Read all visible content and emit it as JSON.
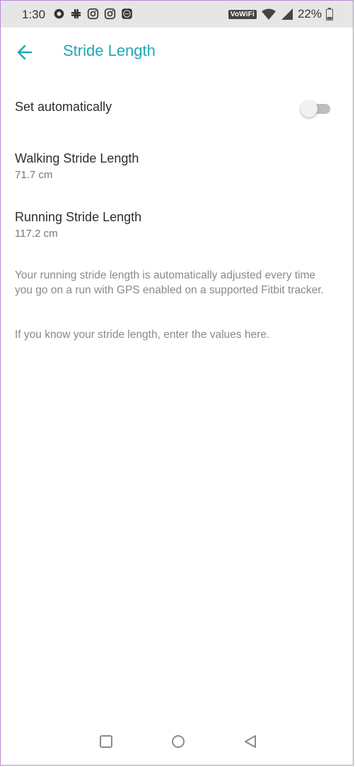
{
  "status_bar": {
    "time": "1:30",
    "left_icons": [
      "o-circle-icon",
      "slack-icon",
      "instagram-icon",
      "instagram-icon",
      "fitbit-icon"
    ],
    "vowifi": "VoWiFi",
    "battery": "22%"
  },
  "app_bar": {
    "title": "Stride Length",
    "back_icon": "arrow-left-icon"
  },
  "settings": {
    "auto": {
      "label": "Set automatically",
      "enabled": false
    },
    "walking": {
      "label": "Walking Stride Length",
      "value": "71.7 cm"
    },
    "running": {
      "label": "Running Stride Length",
      "value": "117.2 cm"
    },
    "info_1": "Your running stride length is automatically adjusted every time you go on a run with GPS enabled on a supported Fitbit tracker.",
    "info_2": "If you know your stride length, enter the values here."
  },
  "colors": {
    "accent": "#1fa8b4",
    "status_bar_bg": "#e6e6e6",
    "text_primary": "#2d2d2d",
    "text_secondary": "#777777"
  }
}
